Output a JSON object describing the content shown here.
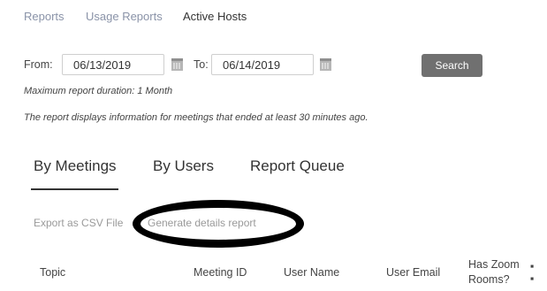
{
  "breadcrumb": {
    "items": [
      "Reports",
      "Usage Reports",
      "Active Hosts"
    ]
  },
  "date_range": {
    "from_label": "From:",
    "from_value": "06/13/2019",
    "to_label": "To:",
    "to_value": "06/14/2019"
  },
  "search_button": "Search",
  "notes": {
    "max_duration": "Maximum report duration: 1 Month",
    "info": "The report displays information for meetings that ended at least 30 minutes ago."
  },
  "tabs": [
    {
      "label": "By Meetings",
      "active": true
    },
    {
      "label": "By Users",
      "active": false
    },
    {
      "label": "Report Queue",
      "active": false
    }
  ],
  "actions": {
    "export_csv": "Export as CSV File",
    "generate_details": "Generate details report"
  },
  "table": {
    "columns": [
      "Topic",
      "Meeting ID",
      "User Name",
      "User Email",
      "Has Zoom Rooms?"
    ]
  },
  "colors": {
    "search_button": "#707070",
    "breadcrumb_link": "#8a93a8",
    "annotation_ellipse": "#000000"
  },
  "icons": [
    "calendar-icon",
    "calendar-icon"
  ]
}
